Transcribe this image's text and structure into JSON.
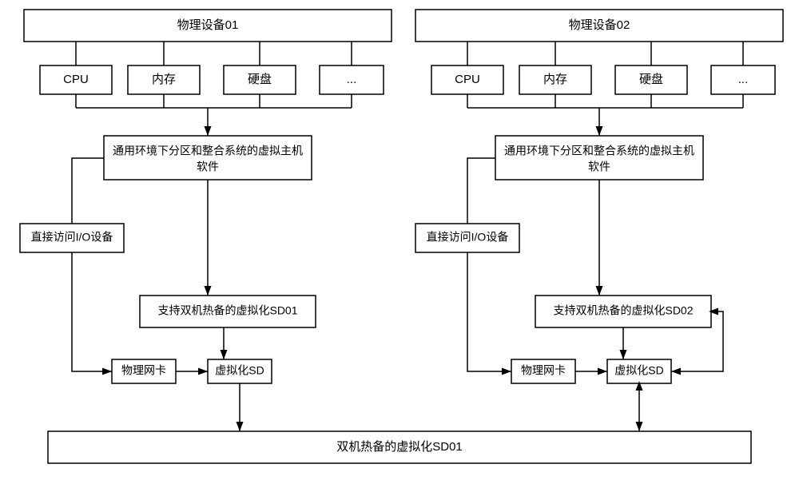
{
  "dev1": {
    "title": "物理设备01",
    "sub": [
      "CPU",
      "内存",
      "硬盘",
      "..."
    ],
    "vm_line1": "通用环境下分区和整合系统的虚拟主机",
    "vm_line2": "软件",
    "io": "直接访问I/O设备",
    "hot_sd": "支持双机热备的虚拟化SD01",
    "pnic": "物理网卡",
    "vsd": "虚拟化SD"
  },
  "dev2": {
    "title": "物理设备02",
    "sub": [
      "CPU",
      "内存",
      "硬盘",
      "..."
    ],
    "vm_line1": "通用环境下分区和整合系统的虚拟主机",
    "vm_line2": "软件",
    "io": "直接访问I/O设备",
    "hot_sd": "支持双机热备的虚拟化SD02",
    "pnic": "物理网卡",
    "vsd": "虚拟化SD"
  },
  "bottom": "双机热备的虚拟化SD01",
  "chart_data": {
    "type": "diagram",
    "nodes": [
      {
        "id": "dev1",
        "label": "物理设备01",
        "children": [
          "CPU",
          "内存",
          "硬盘",
          "..."
        ]
      },
      {
        "id": "vm1",
        "label": "通用环境下分区和整合系统的虚拟主机软件"
      },
      {
        "id": "io1",
        "label": "直接访问I/O设备"
      },
      {
        "id": "hot1",
        "label": "支持双机热备的虚拟化SD01"
      },
      {
        "id": "pnic1",
        "label": "物理网卡"
      },
      {
        "id": "vsd1",
        "label": "虚拟化SD"
      },
      {
        "id": "dev2",
        "label": "物理设备02",
        "children": [
          "CPU",
          "内存",
          "硬盘",
          "..."
        ]
      },
      {
        "id": "vm2",
        "label": "通用环境下分区和整合系统的虚拟主机软件"
      },
      {
        "id": "io2",
        "label": "直接访问I/O设备"
      },
      {
        "id": "hot2",
        "label": "支持双机热备的虚拟化SD02"
      },
      {
        "id": "pnic2",
        "label": "物理网卡"
      },
      {
        "id": "vsd2",
        "label": "虚拟化SD"
      },
      {
        "id": "bottom",
        "label": "双机热备的虚拟化SD01"
      }
    ],
    "edges": [
      [
        "dev1",
        "vm1"
      ],
      [
        "vm1",
        "io1"
      ],
      [
        "vm1",
        "hot1"
      ],
      [
        "io1",
        "pnic1"
      ],
      [
        "hot1",
        "vsd1"
      ],
      [
        "pnic1",
        "vsd1"
      ],
      [
        "vsd1",
        "bottom"
      ],
      [
        "dev2",
        "vm2"
      ],
      [
        "vm2",
        "io2"
      ],
      [
        "vm2",
        "hot2"
      ],
      [
        "io2",
        "pnic2"
      ],
      [
        "hot2",
        "vsd2",
        "bidir"
      ],
      [
        "pnic2",
        "vsd2"
      ],
      [
        "vsd2",
        "bottom",
        "bidir"
      ]
    ]
  }
}
